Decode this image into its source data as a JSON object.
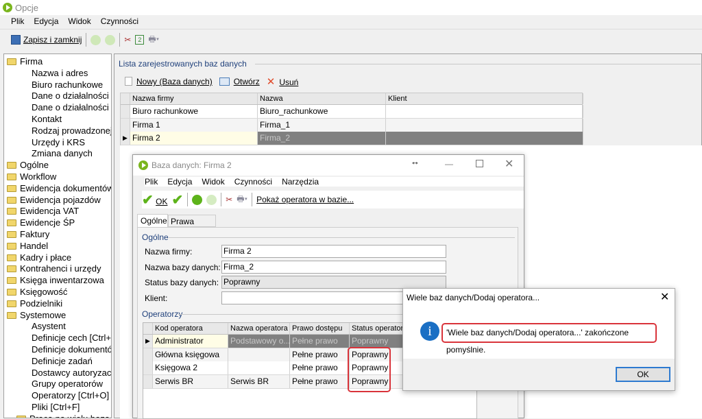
{
  "window": {
    "title": "Opcje",
    "menu": [
      "Plik",
      "Edycja",
      "Widok",
      "Czynności"
    ],
    "toolbar": {
      "save_close": "Zapisz i zamknij"
    }
  },
  "tree": [
    {
      "label": "Firma",
      "level": 0,
      "open": true
    },
    {
      "label": "Nazwa i adres",
      "level": 1
    },
    {
      "label": "Biuro rachunkowe",
      "level": 1
    },
    {
      "label": "Dane o działalności",
      "level": 1
    },
    {
      "label": "Dane o działalności",
      "level": 1
    },
    {
      "label": "Kontakt",
      "level": 1
    },
    {
      "label": "Rodzaj prowadzonej",
      "level": 1
    },
    {
      "label": "Urzędy i KRS",
      "level": 1
    },
    {
      "label": "Zmiana danych",
      "level": 1
    },
    {
      "label": "Ogólne",
      "level": 0
    },
    {
      "label": "Workflow",
      "level": 0
    },
    {
      "label": "Ewidencja dokumentów",
      "level": 0
    },
    {
      "label": "Ewidencja pojazdów",
      "level": 0
    },
    {
      "label": "Ewidencja VAT",
      "level": 0
    },
    {
      "label": "Ewidencje ŚP",
      "level": 0
    },
    {
      "label": "Faktury",
      "level": 0
    },
    {
      "label": "Handel",
      "level": 0
    },
    {
      "label": "Kadry i płace",
      "level": 0
    },
    {
      "label": "Kontrahenci i urzędy",
      "level": 0
    },
    {
      "label": "Księga inwentarzowa",
      "level": 0
    },
    {
      "label": "Księgowość",
      "level": 0
    },
    {
      "label": "Podzielniki",
      "level": 0
    },
    {
      "label": "Systemowe",
      "level": 0,
      "open": true
    },
    {
      "label": "Asystent",
      "level": 1
    },
    {
      "label": "Definicje cech [Ctrl+H",
      "level": 1
    },
    {
      "label": "Definicje dokumentów",
      "level": 1
    },
    {
      "label": "Definicje zadań",
      "level": 1
    },
    {
      "label": "Dostawcy autoryzacji",
      "level": 1
    },
    {
      "label": "Grupy operatorów",
      "level": 1
    },
    {
      "label": "Operatorzy [Ctrl+O]",
      "level": 1
    },
    {
      "label": "Pliki [Ctrl+F]",
      "level": 1
    },
    {
      "label": "Praca na wielu bazach",
      "level": 0.7,
      "open": true
    }
  ],
  "dblist": {
    "group_label": "Lista zarejestrowanych baz danych",
    "toolbar": {
      "new": "Nowy (Baza danych)",
      "open": "Otwórz",
      "delete": "Usuń"
    },
    "columns": [
      "Nazwa firmy",
      "Nazwa",
      "Klient"
    ],
    "rows": [
      [
        "Biuro rachunkowe",
        "Biuro_rachunkowe",
        ""
      ],
      [
        "Firma 1",
        "Firma_1",
        ""
      ],
      [
        "Firma 2",
        "Firma_2",
        ""
      ]
    ]
  },
  "dialog": {
    "title": "Baza danych: Firma 2",
    "menu": [
      "Plik",
      "Edycja",
      "Widok",
      "Czynności",
      "Narzędzia"
    ],
    "toolbar": {
      "ok": "OK",
      "show_operator": "Pokaż operatora w bazie..."
    },
    "tabs": [
      "Ogólne",
      "Prawa danych"
    ],
    "general_group": "Ogólne",
    "fields": [
      {
        "label": "Nazwa firmy:",
        "value": "Firma 2"
      },
      {
        "label": "Nazwa bazy danych:",
        "value": "Firma_2"
      },
      {
        "label": "Status bazy danych:",
        "value": "Poprawny",
        "readonly": true
      },
      {
        "label": "Klient:",
        "value": ""
      }
    ],
    "operators_group": "Operatorzy",
    "op_columns": [
      "Kod operatora",
      "Nazwa operatora",
      "Prawo dostępu",
      "Status operatora"
    ],
    "op_rows": [
      [
        "Administrator",
        "Podstawowy o...",
        "Pełne prawo",
        "Poprawny"
      ],
      [
        "Główna księgowa",
        "",
        "Pełne prawo",
        "Poprawny"
      ],
      [
        "Księgowa 2",
        "",
        "Pełne prawo",
        "Poprawny"
      ],
      [
        "Serwis BR",
        "Serwis BR",
        "Pełne prawo",
        "Poprawny"
      ]
    ]
  },
  "msgbox": {
    "title": "Wiele baz danych/Dodaj operatora...",
    "message": "'Wiele baz danych/Dodaj operatora...' zakończone pomyślnie.",
    "ok": "OK",
    "icon": "info-icon"
  },
  "colors": {
    "accent": "#1e3f7a",
    "highlight": "#d9333a",
    "selected_row": "#808080",
    "info": "#1a6fc4"
  }
}
